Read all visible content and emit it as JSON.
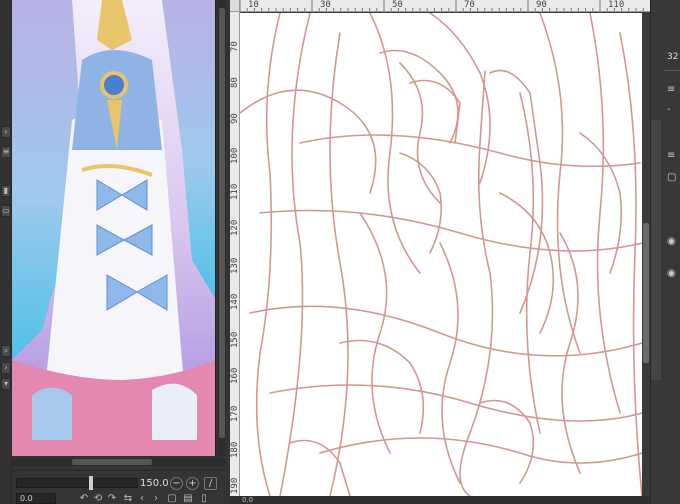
{
  "navigator": {
    "zoom_value": "150.0",
    "angle_value": "0.0"
  },
  "ruler": {
    "top_ticks": [
      "10",
      "30",
      "50",
      "70",
      "90",
      "110"
    ],
    "left_ticks": [
      "70",
      "80",
      "90",
      "100",
      "110",
      "120",
      "130",
      "140",
      "150",
      "160",
      "170",
      "180",
      "190"
    ]
  },
  "status": {
    "zoom_value": "0.0"
  },
  "right_panel": {
    "value_label": "32",
    "item_label": "-"
  },
  "colors": {
    "sketch_stroke": "#cf8c83",
    "canvas_bg": "#ffffff",
    "panel_bg": "#3b3b3b"
  }
}
